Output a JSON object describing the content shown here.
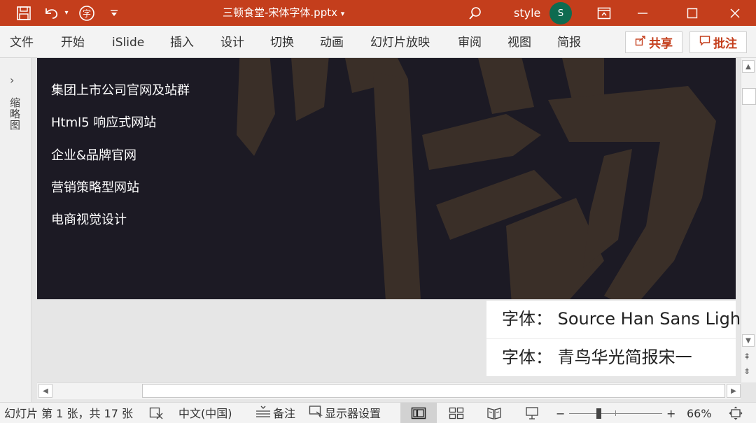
{
  "window": {
    "title": "三顿食堂-宋体字体.pptx",
    "user_name": "style",
    "avatar_initial": "S",
    "accent_color": "#c43e1c"
  },
  "ribbon": {
    "tabs": [
      "文件",
      "开始",
      "iSlide",
      "插入",
      "设计",
      "切换",
      "动画",
      "幻灯片放映",
      "审阅",
      "视图",
      "简报"
    ],
    "share_label": "共享",
    "comment_label": "批注"
  },
  "thumbnail_rail": {
    "label": "缩略图"
  },
  "slide": {
    "background_color": "#1c1a24",
    "menu_items": [
      "集团上市公司官网及站群",
      "Html5 响应式网站",
      "企业&品牌官网",
      "营销策略型网站",
      "电商视觉设计"
    ]
  },
  "font_notes": {
    "line1": "字体：  Source Han Sans Light",
    "line2": "字体：  青鸟华光简报宋一"
  },
  "statusbar": {
    "slide_info": "幻灯片 第 1 张，共 17 张",
    "language": "中文(中国)",
    "notes_label": "备注",
    "display_settings_label": "显示器设置",
    "zoom_minus": "−",
    "zoom_plus": "+",
    "zoom_level": "66%"
  },
  "icons": [
    "save-icon",
    "undo-icon",
    "font-icon",
    "customize-icon",
    "search-icon",
    "ribbon-display-icon",
    "minimize-icon",
    "maximize-icon",
    "close-icon",
    "share-icon",
    "comment-icon",
    "chevron-right-icon",
    "accessibility-icon",
    "notes-icon",
    "display-settings-icon",
    "normal-view-icon",
    "slide-sorter-icon",
    "reading-view-icon",
    "slideshow-icon",
    "fit-slide-icon"
  ]
}
